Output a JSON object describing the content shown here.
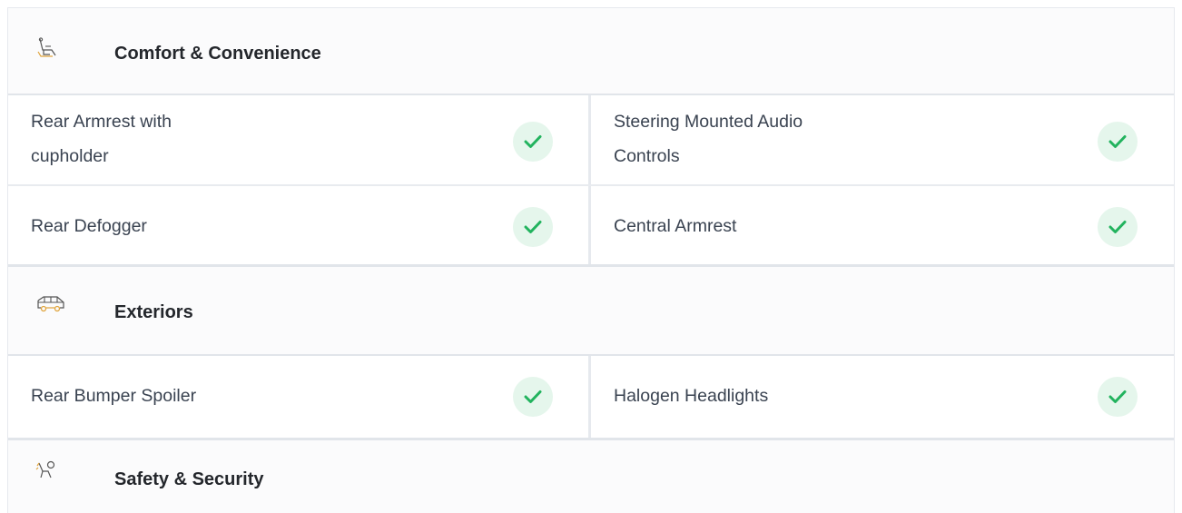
{
  "sections": [
    {
      "title": "Comfort & Convenience",
      "icon": "seat-icon",
      "rows": [
        [
          "Rear Armrest with cupholder",
          "Steering Mounted Audio Controls"
        ],
        [
          "Rear Defogger",
          "Central Armrest"
        ]
      ]
    },
    {
      "title": "Exteriors",
      "icon": "car-exterior-icon",
      "rows": [
        [
          "Rear Bumper Spoiler",
          "Halogen Headlights"
        ]
      ]
    },
    {
      "title": "Safety & Security",
      "icon": "airbag-icon",
      "rows": []
    }
  ],
  "features": {
    "rear_armrest_l1": "Rear Armrest with",
    "rear_armrest_l2": "cupholder",
    "steering_l1": "Steering Mounted Audio",
    "steering_l2": "Controls",
    "rear_defogger": "Rear Defogger",
    "central_armrest": "Central Armrest",
    "rear_bumper_spoiler": "Rear Bumper Spoiler",
    "halogen_headlights": "Halogen Headlights"
  },
  "colors": {
    "check_green": "#22b35e",
    "check_bg": "#e5f6ec",
    "icon_orange": "#e0a43c"
  }
}
